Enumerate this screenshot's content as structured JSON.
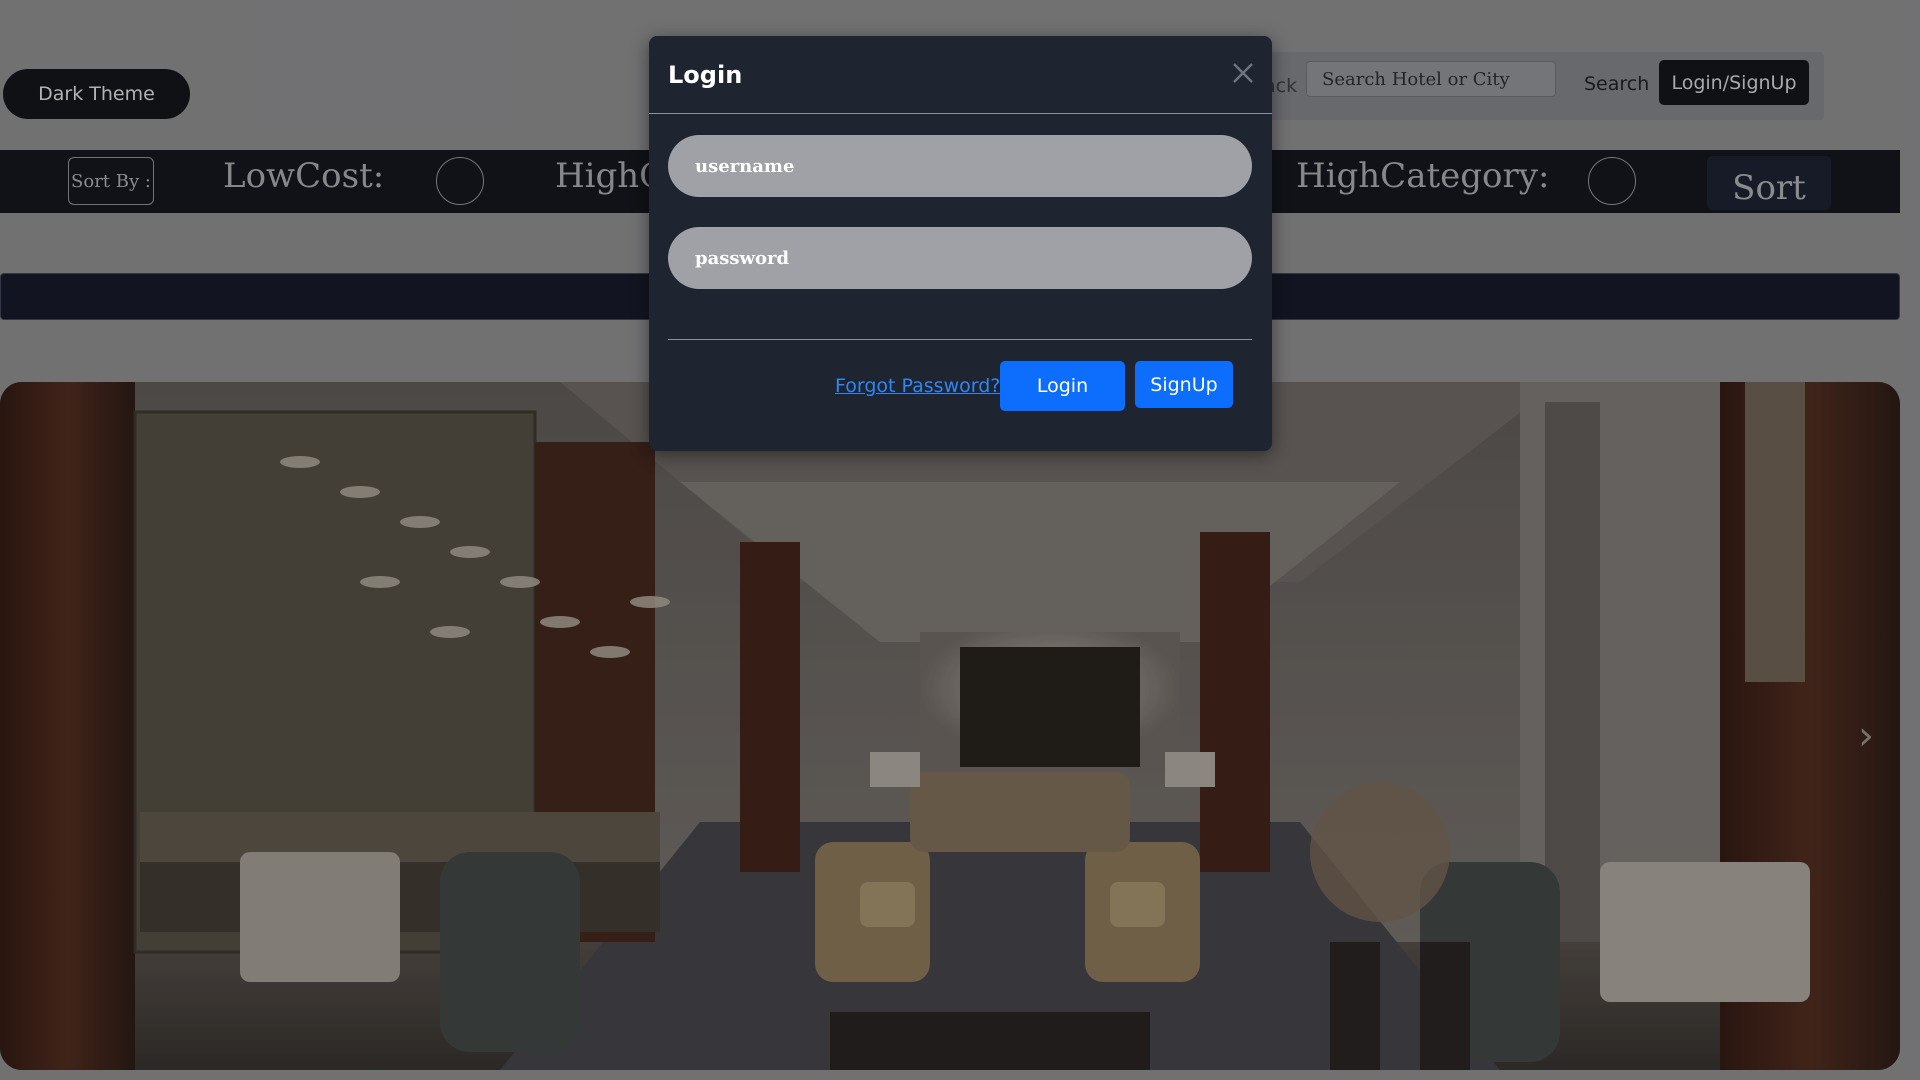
{
  "header": {
    "theme_toggle_label": "Dark Theme",
    "nav_partial_text": "ack",
    "search_placeholder": "Search Hotel or City",
    "search_label": "Search",
    "login_signup_label": "Login/SignUp"
  },
  "sort_bar": {
    "sort_by_label": "Sort By :",
    "low_cost_label": "LowCost:",
    "high_cost_partial_label": "HighC",
    "high_category_label": "HighCategory:",
    "sort_button_label": "Sort"
  },
  "login_modal": {
    "title": "Login",
    "username_placeholder": "username",
    "password_placeholder": "password",
    "forgot_password_label": "Forgot Password?",
    "login_button_label": "Login",
    "signup_button_label": "SignUp"
  },
  "hero": {
    "image_subject": "hotel lobby lounge",
    "next_arrow": "›"
  },
  "colors": {
    "modal_bg": "#1f2431",
    "primary_button": "#0d6efd",
    "link": "#2f86f4",
    "sort_bar_bg": "#14171d",
    "dark_button": "#13151a"
  }
}
